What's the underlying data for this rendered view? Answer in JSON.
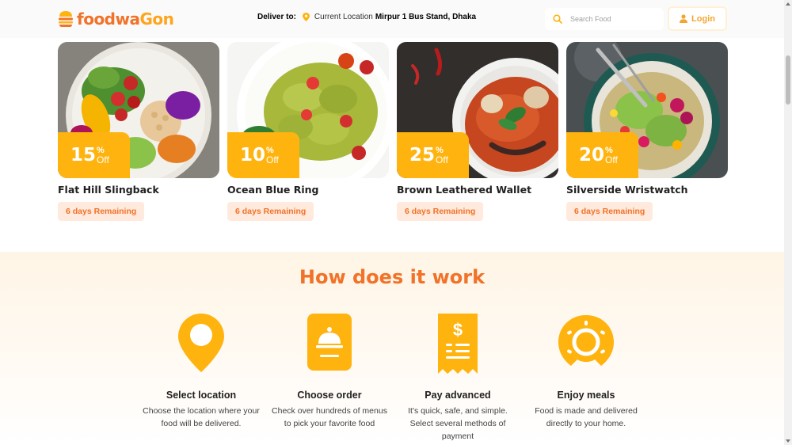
{
  "header": {
    "logo_text_1": "foodwa",
    "logo_text_2": "Gon",
    "deliver_label": "Deliver to:",
    "current_location_label": "Current Location",
    "current_location_value": "Mirpur 1 Bus Stand, Dhaka",
    "search_placeholder": "Search Food",
    "login_label": "Login"
  },
  "offers": [
    {
      "title": "Flat Hill Slingback",
      "discount": "15",
      "pct": "%",
      "off": "Off",
      "remaining": "6 days Remaining",
      "image": "salad-bowl"
    },
    {
      "title": "Ocean Blue Ring",
      "discount": "10",
      "pct": "%",
      "off": "Off",
      "remaining": "6 days Remaining",
      "image": "pasta-bowl"
    },
    {
      "title": "Brown Leathered Wallet",
      "discount": "25",
      "pct": "%",
      "off": "Off",
      "remaining": "6 days Remaining",
      "image": "soup-bowl"
    },
    {
      "title": "Silverside Wristwatch",
      "discount": "20",
      "pct": "%",
      "off": "Off",
      "remaining": "6 days Remaining",
      "image": "grain-bowl"
    }
  ],
  "how": {
    "title": "How does it work",
    "steps": [
      {
        "icon": "location-pin-icon",
        "title": "Select location",
        "desc": "Choose the location where your food will be delivered."
      },
      {
        "icon": "order-bell-icon",
        "title": "Choose order",
        "desc": "Check over hundreds of menus to pick your favorite food"
      },
      {
        "icon": "receipt-icon",
        "title": "Pay advanced",
        "desc": "It's quick, safe, and simple. Select several methods of payment"
      },
      {
        "icon": "meal-donut-icon",
        "title": "Enjoy meals",
        "desc": "Food is made and delivered directly to your home."
      }
    ]
  },
  "colors": {
    "brand_orange": "#f17228",
    "brand_yellow": "#ffb30e",
    "badge_bg": "#ffeadd"
  }
}
